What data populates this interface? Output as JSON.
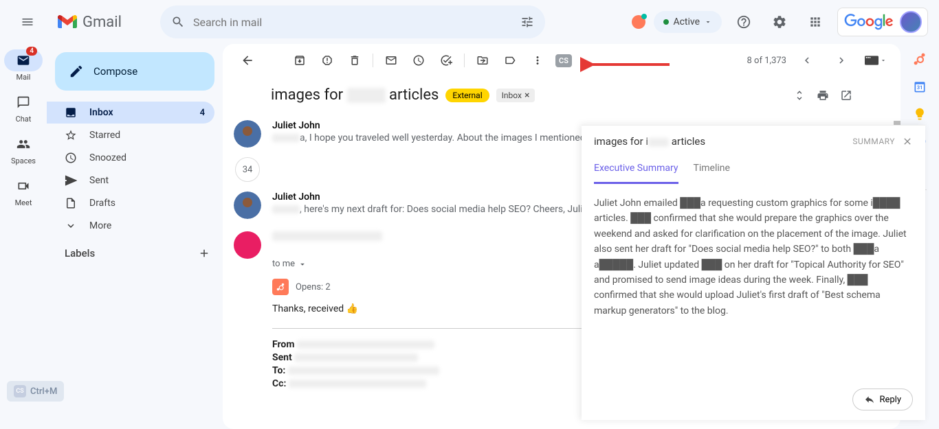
{
  "header": {
    "app_name": "Gmail",
    "search_placeholder": "Search in mail",
    "active_label": "Active",
    "google_label": "Google"
  },
  "rail": {
    "mail": "Mail",
    "mail_badge": "4",
    "chat": "Chat",
    "spaces": "Spaces",
    "meet": "Meet",
    "shortcut": "Ctrl+M"
  },
  "sidebar": {
    "compose": "Compose",
    "items": [
      {
        "label": "Inbox",
        "count": "4"
      },
      {
        "label": "Starred"
      },
      {
        "label": "Snoozed"
      },
      {
        "label": "Sent"
      },
      {
        "label": "Drafts"
      },
      {
        "label": "More"
      }
    ],
    "labels_header": "Labels"
  },
  "toolbar": {
    "position": "8 of 1,373",
    "cs_badge": "CS"
  },
  "conversation": {
    "subject_prefix": "images for ",
    "subject_suffix": " articles",
    "external": "External",
    "inbox_chip": "Inbox",
    "thread_count": "34",
    "messages": [
      {
        "sender": "Juliet John",
        "preview_suffix": "a, I hope you traveled well yesterday. About the images I mentioned to"
      },
      {
        "sender": "Juliet John",
        "preview_suffix": ", here's my next draft for: Does social media help SEO? Cheers, Juli"
      }
    ],
    "expanded": {
      "to_prefix": "to me",
      "opens": "Opens: 2",
      "body": "Thanks, received 👍",
      "from_label": "From",
      "sent_label": "Sent",
      "to_label": "To:",
      "cc_label": "Cc:"
    }
  },
  "summary": {
    "title_prefix": "images for i",
    "title_suffix": " articles",
    "header_label": "SUMMARY",
    "tab1": "Executive Summary",
    "tab2": "Timeline",
    "body": "Juliet John emailed ███a requesting custom graphics for some i████ articles. ███ confirmed that she would prepare the graphics over the weekend and asked for clarification on the placement of the image. Juliet also sent her draft for \"Does social media help SEO?\" to both ███a a█████. Juliet updated ███ on her draft for \"Topical Authority for SEO\" and promised to send image ideas during the week. Finally, ███ confirmed that she would upload Juliet's first draft of \"Best schema markup generators\" to the blog.",
    "reply": "Reply"
  }
}
